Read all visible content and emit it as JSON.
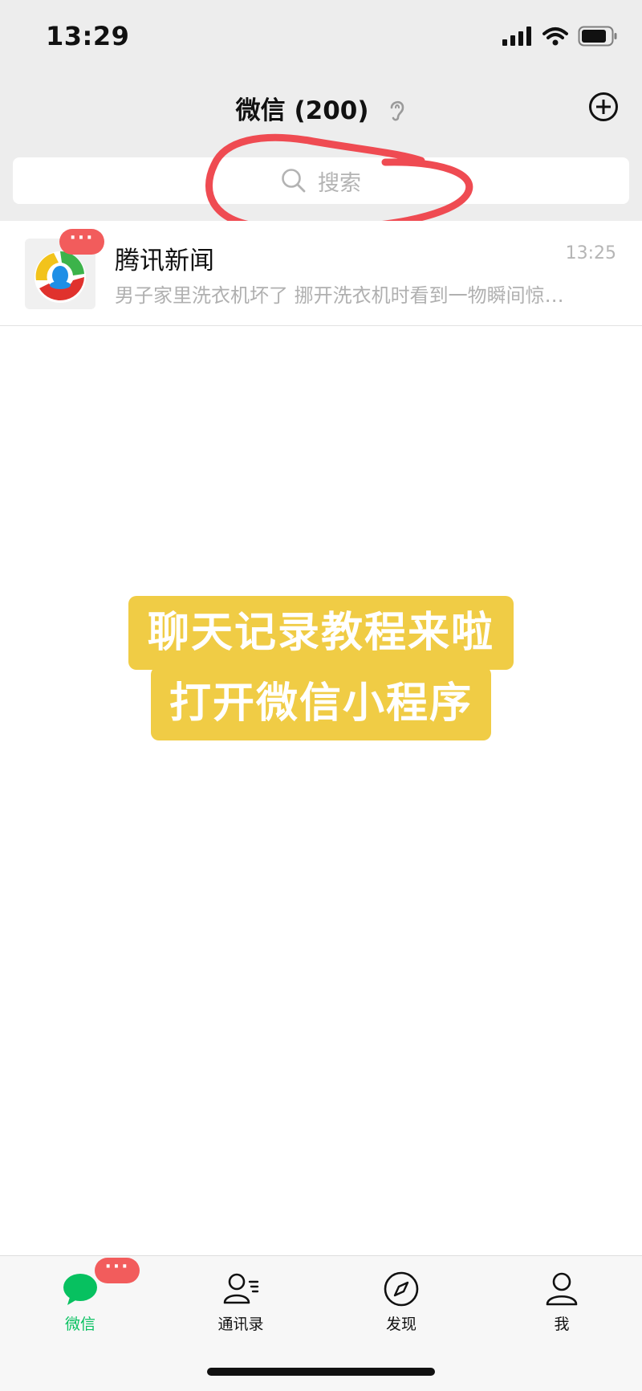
{
  "status_bar": {
    "time": "13:29"
  },
  "nav": {
    "title": "微信 (200)"
  },
  "search": {
    "placeholder": "搜索"
  },
  "chats": [
    {
      "name": "腾讯新闻",
      "time": "13:25",
      "preview": "男子家里洗衣机坏了 挪开洗衣机时看到一物瞬间惊…",
      "badge": "···"
    }
  ],
  "overlay": {
    "line1": "聊天记录教程来啦",
    "line2": "打开微信小程序"
  },
  "tabs": [
    {
      "label": "微信",
      "icon": "chat-bubble-icon",
      "active": true,
      "badge": "···"
    },
    {
      "label": "通讯录",
      "icon": "contacts-icon",
      "active": false
    },
    {
      "label": "发现",
      "icon": "compass-icon",
      "active": false
    },
    {
      "label": "我",
      "icon": "person-icon",
      "active": false
    }
  ],
  "colors": {
    "accent": "#07c160",
    "badge": "#f25c5c",
    "overlay_bg": "#f0cc45",
    "annotation": "#ef4b52"
  }
}
